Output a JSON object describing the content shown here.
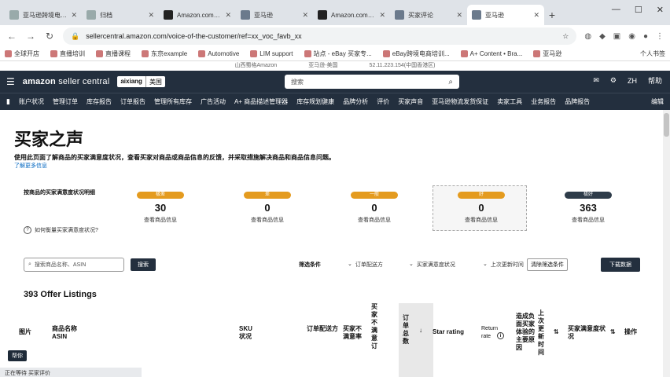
{
  "browser": {
    "tabs": [
      {
        "title": "亚马逊跨境电商培训专",
        "active": false,
        "favicon": "tabs-icon"
      },
      {
        "title": "归档",
        "active": false,
        "favicon": "tabs-icon"
      },
      {
        "title": "Amazon.com: M2",
        "active": false,
        "favicon": "amazon-icon"
      },
      {
        "title": "亚马逊",
        "active": false,
        "favicon": "doc-icon"
      },
      {
        "title": "Amazon.com: Am",
        "active": false,
        "favicon": "amazon-icon"
      },
      {
        "title": "买家评论",
        "active": false,
        "favicon": "doc-icon"
      },
      {
        "title": "亚马逊",
        "active": true,
        "favicon": "doc-icon"
      }
    ],
    "url": "sellercentral.amazon.com/voice-of-the-customer/ref=xx_voc_favb_xx",
    "bookmarks": [
      "全球开店",
      "直播培训",
      "直播课程",
      "东京example",
      "Automotive",
      "LIM support",
      "站点 - eBay 买家专...",
      "eBay跨境电商培训...",
      "A+ Content • Bra...",
      "亚马逊"
    ],
    "bookmarks_right": "个人书签",
    "info_line": [
      "山西蜀格Amazon",
      "亚马逊-美国",
      "52.11.223.154(中国香港区)"
    ]
  },
  "header": {
    "logo_bold": "amazon",
    "logo_light": "seller central",
    "account": "aixiang",
    "marketplace": "美国",
    "search_placeholder": "搜索",
    "language": "ZH",
    "help": "帮助"
  },
  "nav": {
    "items": [
      "账户状况",
      "管理订单",
      "库存报告",
      "订单报告",
      "管理所有库存",
      "广告活动",
      "A+ 商品描述管理器",
      "库存规划健康",
      "品牌分析",
      "评价",
      "买家声音",
      "亚马逊物流发货保证",
      "卖家工具",
      "业务报告",
      "品牌报告"
    ],
    "edit": "编辑"
  },
  "page": {
    "title": "买家之声",
    "intro": "使用此页面了解商品的买家满意度状况，查看买家对商品或商品信息的反馈，并采取措施解决商品和商品信息问题。",
    "learn_more": "了解更多信息",
    "breakdown_label": "按商品的买家满意度状况明细",
    "help_link": "如何衡量买家满意度状况?",
    "stats": [
      {
        "badge": "极差",
        "count": "30",
        "link": "查看商品信息",
        "color": "#e49b1f"
      },
      {
        "badge": "差",
        "count": "0",
        "link": "查看商品信息",
        "color": "#e49b1f"
      },
      {
        "badge": "一般",
        "count": "0",
        "link": "查看商品信息",
        "color": "#e49b1f"
      },
      {
        "badge": "好",
        "count": "0",
        "link": "查看商品信息",
        "color": "#e49b1f"
      },
      {
        "badge": "极好",
        "count": "363",
        "link": "查看商品信息",
        "color": "#2e3c49"
      }
    ],
    "search_placeholder": "搜索商品名称、ASIN",
    "search_button": "搜索",
    "filter_label": "筛选条件",
    "filters": [
      "订单配送方",
      "买家满意度状况",
      "上次更新时间"
    ],
    "clear_filters": "清除筛选条件",
    "download": "下载数据",
    "listing_count": "393 Offer Listings",
    "columns": {
      "image": "图片",
      "name": "商品名称",
      "asin": "ASIN",
      "sku": "SKU",
      "status": "状况",
      "fulfillment": "订单配送方",
      "dissatisfaction_rate": "买家不满意率",
      "dissatisfied_orders": "买家不满意订",
      "total_orders": "订单总数",
      "star_rating": "Star rating",
      "return_rate": "Return rate",
      "main_cause": "造成负面买家体验的主要原因",
      "last_updated": "上次更新时间",
      "satisfaction_status": "买家满意度状况",
      "actions": "操作"
    }
  },
  "status_pill": "帮你",
  "status_bar": "正在等待 买家评价"
}
